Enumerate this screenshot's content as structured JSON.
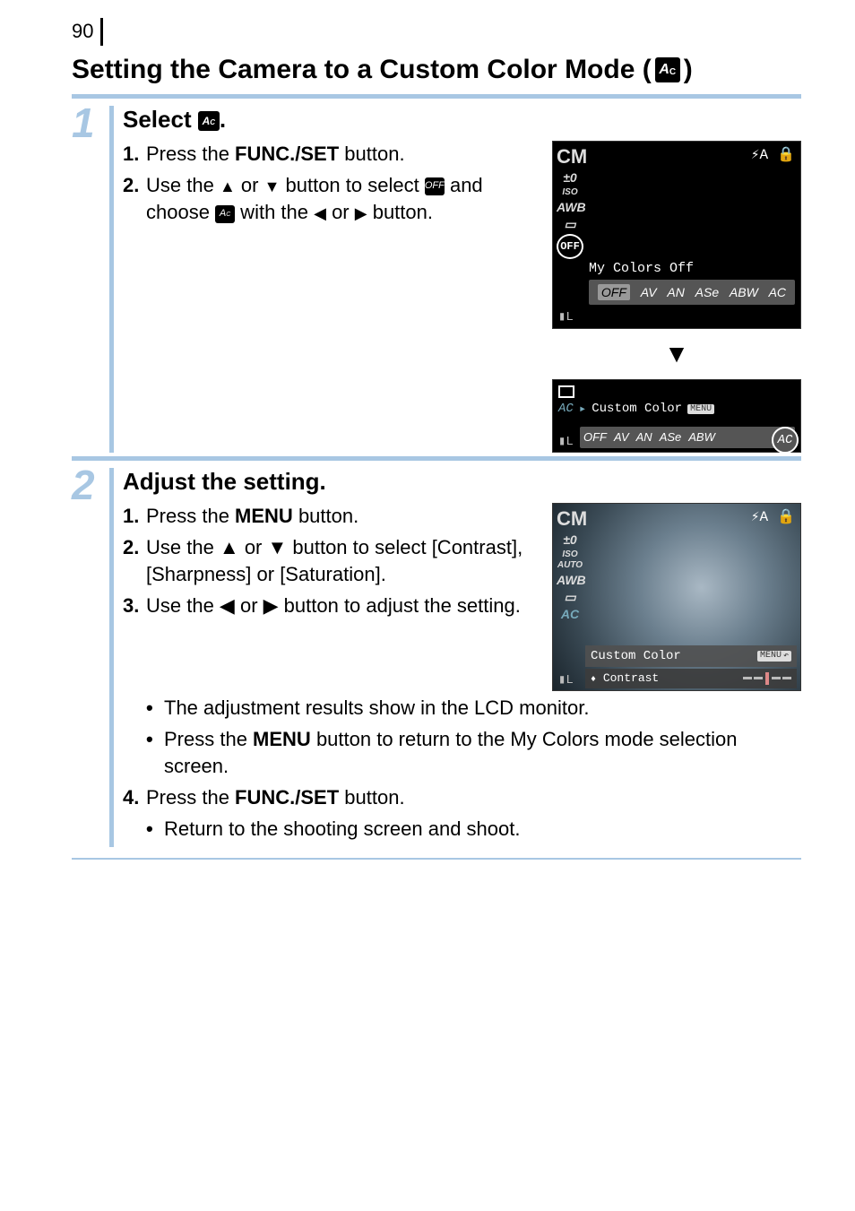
{
  "page_number": "90",
  "title": "Setting the Camera to a Custom Color Mode (",
  "title_icon_label": "AC",
  "title_close": ")",
  "step1": {
    "num": "1",
    "title_pre": "Select ",
    "title_icon": "AC",
    "title_post": ".",
    "items": [
      {
        "n": "1.",
        "before": "Press the ",
        "bold": "FUNC./SET",
        "after": " button."
      },
      {
        "n": "2.",
        "line1_a": "Use the ",
        "line1_b": " or ",
        "line1_c": " button to select ",
        "line2_a": "and choose ",
        "line2_b": " with the ",
        "line2_c": " or ",
        "line2_d": " button."
      }
    ]
  },
  "step2": {
    "num": "2",
    "title": "Adjust the setting.",
    "items": [
      {
        "n": "1.",
        "before": "Press the ",
        "bold": "MENU",
        "after": " button."
      },
      {
        "n": "2.",
        "text": "Use the ▲ or ▼ button to select [Contrast], [Sharpness] or [Saturation]."
      },
      {
        "n": "3.",
        "text": "Use the ◀ or ▶ button to adjust the setting."
      }
    ],
    "bullets1": [
      "The adjustment results show in the LCD monitor.",
      "Press the MENU button to return to the My Colors mode selection screen."
    ],
    "item4": {
      "n": "4.",
      "before": "Press the ",
      "bold": "FUNC./SET",
      "after": " button."
    },
    "bullets2": [
      "Return to the shooting screen and shoot."
    ]
  },
  "screen1": {
    "topright": [
      "⚡A",
      "🔒"
    ],
    "sidebar": [
      "CM",
      "±0",
      "ISO",
      "AWB",
      "▭"
    ],
    "circled": "OFF",
    "strip_label": "My Colors Off",
    "options": [
      "OFF",
      "AV",
      "AN",
      "ASe",
      "ABW",
      "AC"
    ],
    "histo": "▮L"
  },
  "screen2": {
    "ac": "AC",
    "label": "Custom Color",
    "menu": "MENU",
    "options": [
      "OFF",
      "AV",
      "AN",
      "ASe",
      "ABW"
    ],
    "circled": "AC",
    "histo": "▮L"
  },
  "screen3": {
    "topright": [
      "⚡A",
      "🔒"
    ],
    "sidebar": [
      "CM",
      "±0",
      "ISO",
      "AWB",
      "▭",
      "AC"
    ],
    "bar_label": "Custom Color",
    "menu": "MENU",
    "back": "↶",
    "contrast_label": "Contrast",
    "histo": "▮L"
  }
}
